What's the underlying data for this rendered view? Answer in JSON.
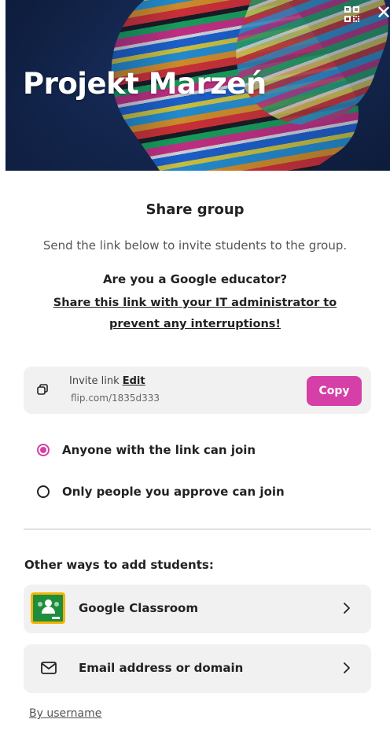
{
  "header": {
    "group_name": "Projekt Marzeń",
    "qr_icon": "qr-code-icon",
    "close_icon": "close-icon",
    "close_glyph": "✕"
  },
  "dialog": {
    "title": "Share group",
    "subtitle": "Send the link below to invite students to the group.",
    "google_question": "Are you a Google educator?",
    "google_notice": "Share this link with your IT administrator to prevent any interruptions!"
  },
  "invite": {
    "label": "Invite link",
    "edit_label": "Edit",
    "url": "flip.com/1835d333",
    "copy_label": "Copy"
  },
  "access": {
    "options": [
      {
        "label": "Anyone with the link can join",
        "selected": true
      },
      {
        "label": "Only people you approve can join",
        "selected": false
      }
    ]
  },
  "other": {
    "title": "Other ways to add students:",
    "items": [
      {
        "label": "Google Classroom",
        "icon": "google-classroom-icon"
      },
      {
        "label": "Email address or domain",
        "icon": "envelope-icon"
      }
    ],
    "username_link": "By username"
  },
  "colors": {
    "accent": "#d63fa8",
    "card_bg": "#f1f1f1",
    "banner_bg": "#1c3468"
  }
}
